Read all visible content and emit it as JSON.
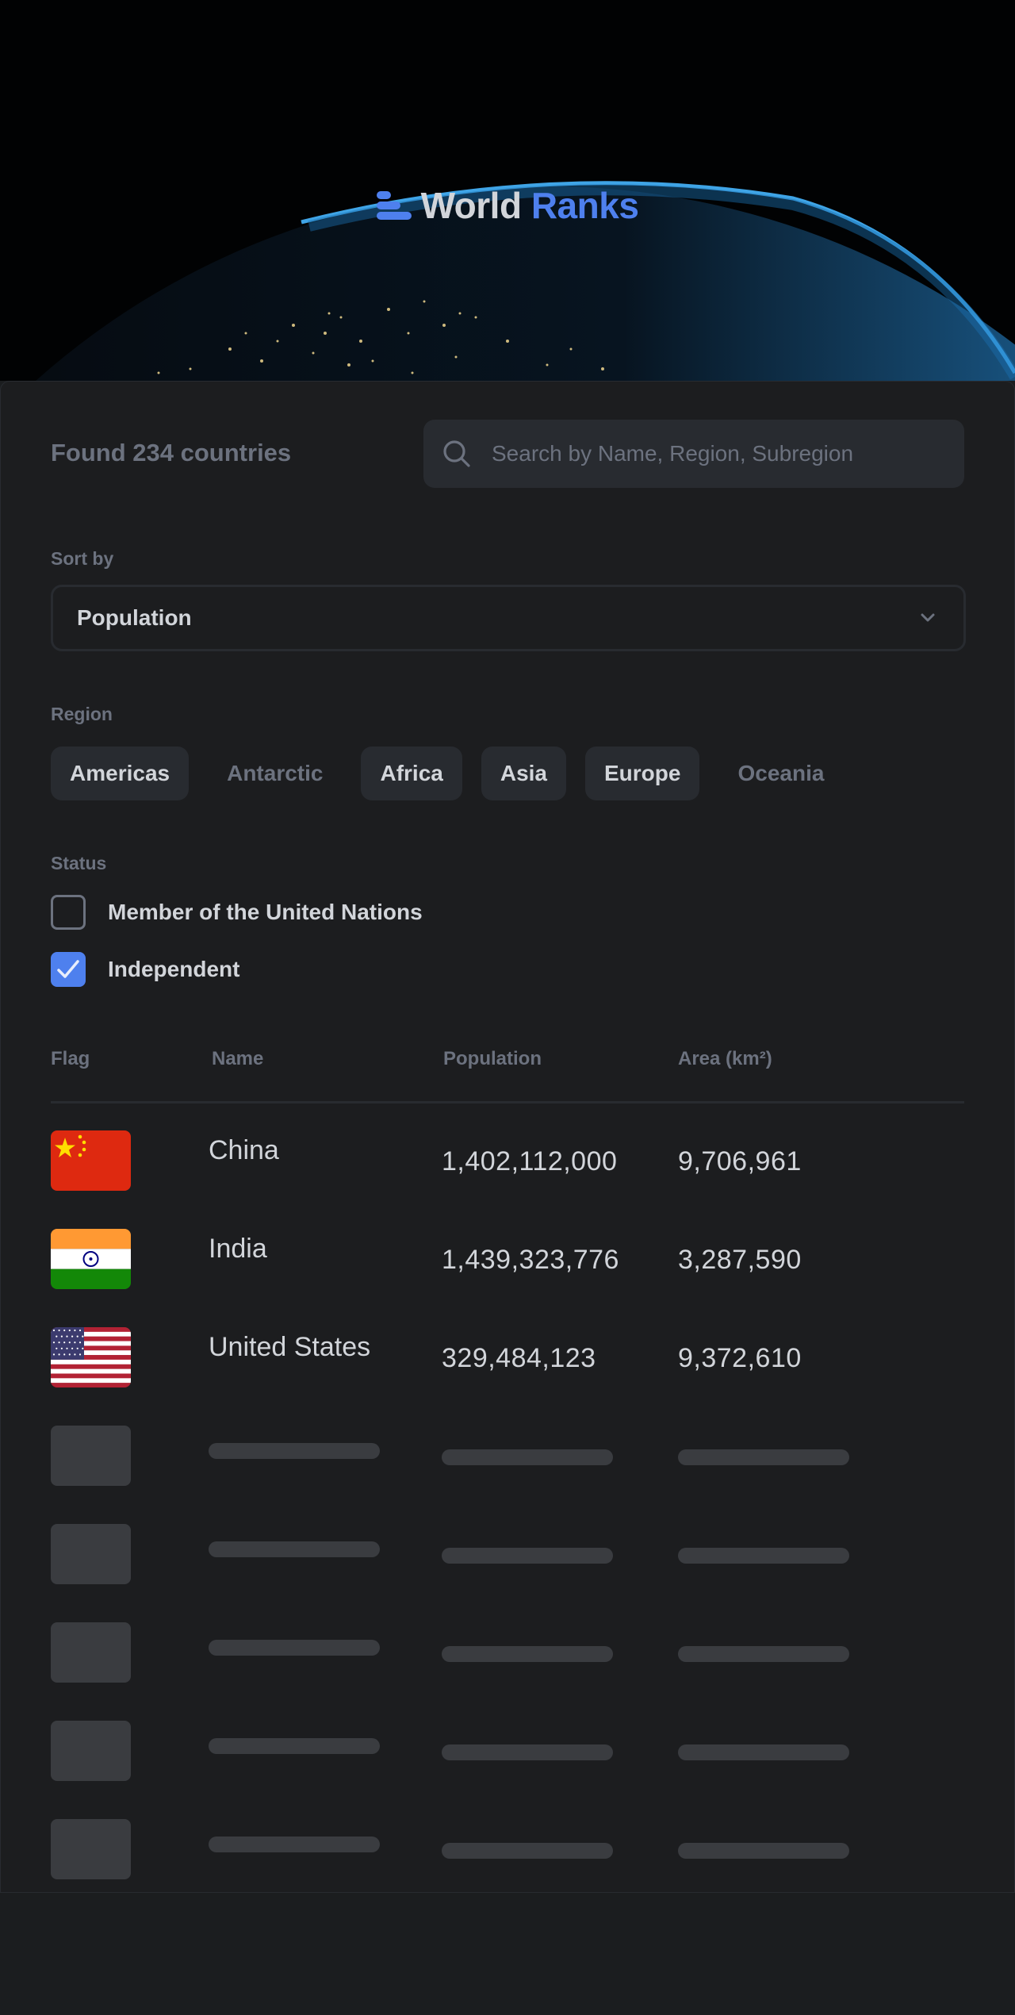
{
  "app": {
    "logo_first": "World",
    "logo_second": "Ranks",
    "accent_color": "#4e80ee"
  },
  "summary": {
    "found_text": "Found 234 countries"
  },
  "search": {
    "placeholder": "Search by Name, Region, Subregion",
    "value": "",
    "icon": "search-icon"
  },
  "sort": {
    "label": "Sort by",
    "selected": "Population",
    "icon": "chevron-down-icon"
  },
  "region": {
    "label": "Region",
    "options": [
      {
        "label": "Americas",
        "selected": true
      },
      {
        "label": "Antarctic",
        "selected": false
      },
      {
        "label": "Africa",
        "selected": true
      },
      {
        "label": "Asia",
        "selected": true
      },
      {
        "label": "Europe",
        "selected": true
      },
      {
        "label": "Oceania",
        "selected": false
      }
    ]
  },
  "status": {
    "label": "Status",
    "options": [
      {
        "label": "Member of the United Nations",
        "checked": false
      },
      {
        "label": "Independent",
        "checked": true
      }
    ]
  },
  "table": {
    "headers": [
      "Flag",
      "Name",
      "Population",
      "Area (km²)"
    ],
    "rows": [
      {
        "flag": "china-flag",
        "name": "China",
        "population": "1,402,112,000",
        "area": "9,706,961"
      },
      {
        "flag": "india-flag",
        "name": "India",
        "population": "1,439,323,776",
        "area": "3,287,590"
      },
      {
        "flag": "united-states-flag",
        "name": "United States",
        "population": "329,484,123",
        "area": "9,372,610"
      }
    ],
    "loading_rows": 5
  }
}
